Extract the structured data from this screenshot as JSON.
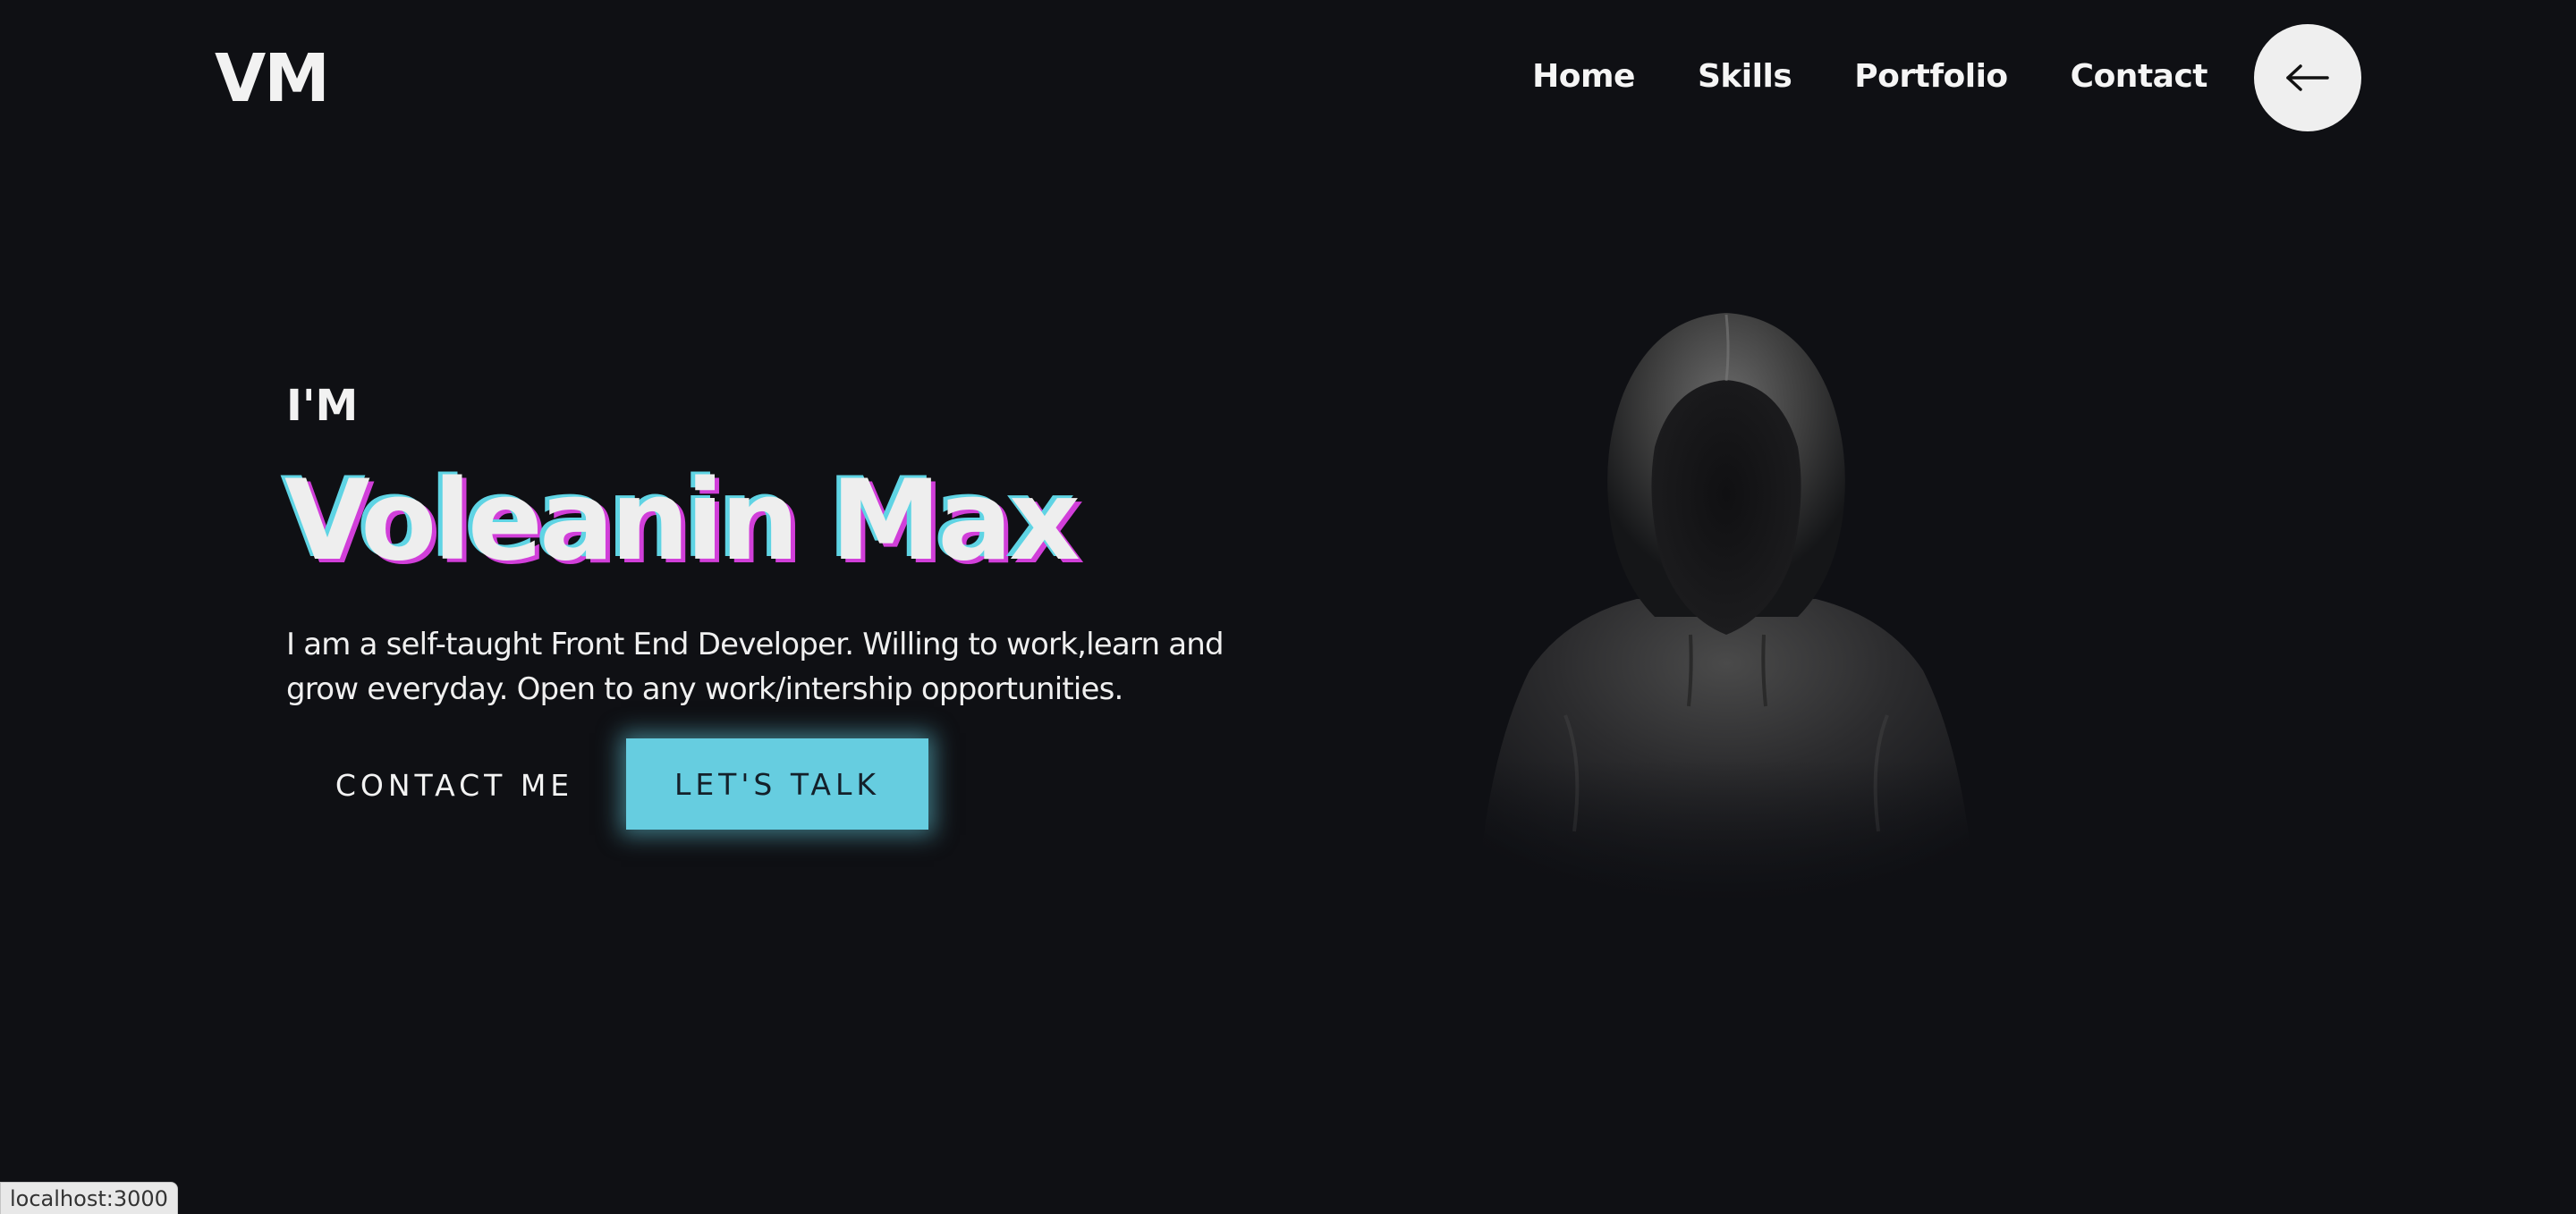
{
  "header": {
    "logo": "VM",
    "nav": [
      "Home",
      "Skills",
      "Portfolio",
      "Contact"
    ],
    "back_icon": "arrow-left-icon"
  },
  "hero": {
    "intro": "I'M",
    "name": "Voleanin Max",
    "description": "I am a self-taught Front End Developer. Willing to work,learn and grow everyday. Open to any work/intership opportunities.",
    "contact_button": "CONTACT ME",
    "talk_button": "LET'S TALK",
    "image": "hooded-figure"
  },
  "colors": {
    "background": "#0f1014",
    "accent": "#66cde0",
    "text_shadow_pink": "#d13fd9"
  },
  "status_bar": {
    "url": "localhost:3000"
  }
}
